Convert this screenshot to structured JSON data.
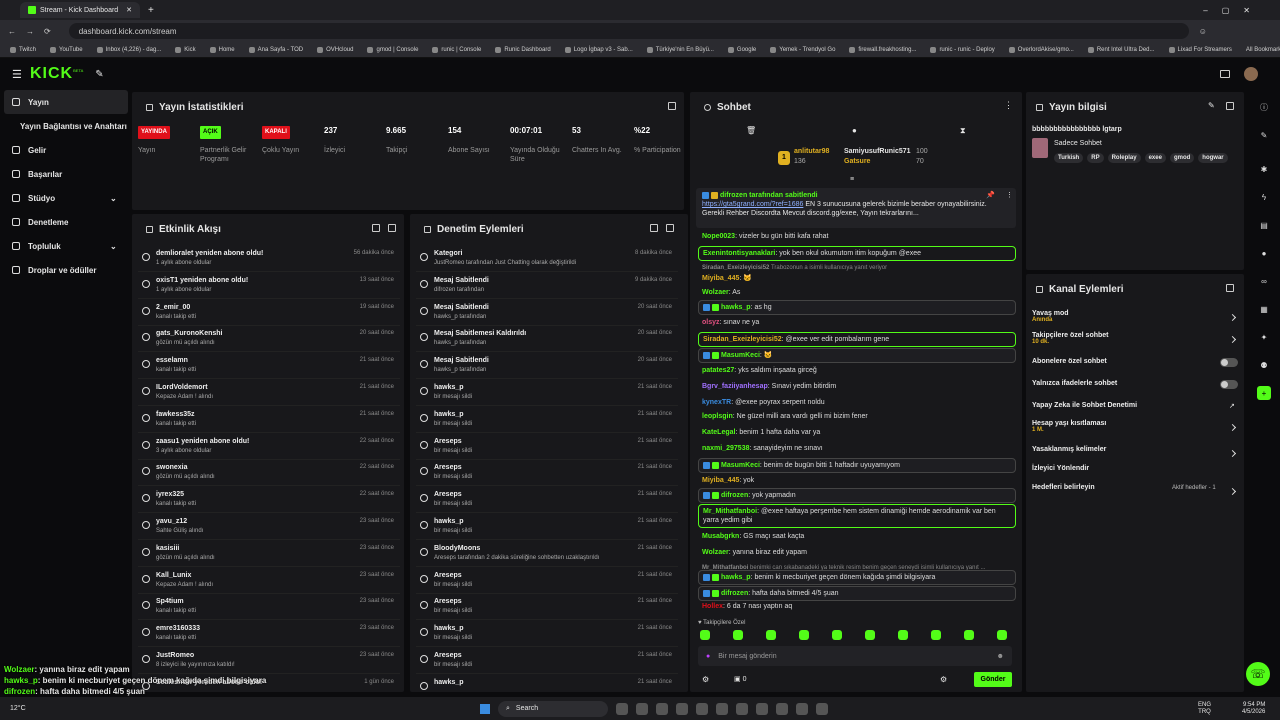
{
  "browser": {
    "tab_title": "Stream - Kick Dashboard",
    "url": "dashboard.kick.com/stream",
    "bookmarks": [
      "Twitch",
      "YouTube",
      "Inbox (4,226) - dag...",
      "Kick",
      "Home",
      "Ana Sayfa - TOD",
      "OVHcloud",
      "gmod | Console",
      "runic | Console",
      "Runic Dashboard",
      "Logo İgbap v3 - Sab...",
      "Türkiye'nin En Büyü...",
      "Google",
      "Yemek - Trendyol Go",
      "firewall.freakhosting...",
      "runic - runic - Deploy",
      "OverlordAkise/gmo...",
      "Rent Intel Ultra Ded...",
      "Lixad For Streamers"
    ],
    "all_bookmarks": "All Bookmarks"
  },
  "app": {
    "logo": "KICK",
    "beta": "BETA"
  },
  "sidebar": {
    "items": [
      {
        "label": "Yayın"
      },
      {
        "label": "Yayın Bağlantısı ve Anahtarı"
      },
      {
        "label": "Gelir"
      },
      {
        "label": "Başarılar"
      },
      {
        "label": "Stüdyo"
      },
      {
        "label": "Denetleme"
      },
      {
        "label": "Topluluk"
      },
      {
        "label": "Droplar ve ödüller"
      }
    ]
  },
  "stats": {
    "title": "Yayın İstatistikleri",
    "items": [
      {
        "value": "YAYINDA",
        "label": "Yayın",
        "badge": "#e0101a"
      },
      {
        "value": "AÇIK",
        "label": "Partnerlik Gelir Programı",
        "badge": "#53fc18"
      },
      {
        "value": "KAPALI",
        "label": "Çoklu Yayın",
        "badge": "#e0101a"
      },
      {
        "value": "237",
        "label": "İzleyici"
      },
      {
        "value": "9.665",
        "label": "Takipçi"
      },
      {
        "value": "154",
        "label": "Abone Sayısı"
      },
      {
        "value": "00:07:01",
        "label": "Yayında Olduğu Süre"
      },
      {
        "value": "53",
        "label": "Chatters In Avg."
      },
      {
        "value": "%22",
        "label": "% Participation"
      }
    ]
  },
  "activity": {
    "title": "Etkinlik Akışı",
    "items": [
      {
        "t": "demlioralet yeniden abone oldu!",
        "s": "1 aylık abone oldular",
        "tm": "56 dakika önce"
      },
      {
        "t": "oxisT1 yeniden abone oldu!",
        "s": "1 aylık abone oldular",
        "tm": "13 saat önce"
      },
      {
        "t": "2_emir_00",
        "s": "kanalı takip etti",
        "tm": "19 saat önce"
      },
      {
        "t": "gats_KuronoKenshi",
        "s": "gözün mü açıldı alındı",
        "tm": "20 saat önce"
      },
      {
        "t": "esselamn",
        "s": "kanalı takip etti",
        "tm": "21 saat önce"
      },
      {
        "t": "ILordVoldemort",
        "s": "Kepaze Adam ! alındı",
        "tm": "21 saat önce"
      },
      {
        "t": "fawkess35z",
        "s": "kanalı takip etti",
        "tm": "21 saat önce"
      },
      {
        "t": "zaasu1 yeniden abone oldu!",
        "s": "3 aylık abone oldular",
        "tm": "22 saat önce"
      },
      {
        "t": "swonexia",
        "s": "gözün mü açıldı alındı",
        "tm": "22 saat önce"
      },
      {
        "t": "iyrex325",
        "s": "kanalı takip etti",
        "tm": "22 saat önce"
      },
      {
        "t": "yavu_z12",
        "s": "Sahte Güliş alındı",
        "tm": "23 saat önce"
      },
      {
        "t": "kasisiii",
        "s": "gözün mü açıldı alındı",
        "tm": "23 saat önce"
      },
      {
        "t": "Kall_Lunix",
        "s": "Kepaze Adam ! alındı",
        "tm": "23 saat önce"
      },
      {
        "t": "Sp4tium",
        "s": "kanalı takip etti",
        "tm": "23 saat önce"
      },
      {
        "t": "emre3160333",
        "s": "kanalı takip etti",
        "tm": "23 saat önce"
      },
      {
        "t": "JustRomeo",
        "s": "8 izleyici ile yayınınıza katıldı!",
        "tm": "23 saat önce"
      },
      {
        "t": "Sealesnow yeniden abone oldu!",
        "s": "",
        "tm": "1 gün önce"
      }
    ]
  },
  "moderation": {
    "title": "Denetim Eylemleri",
    "items": [
      {
        "t": "Kategori",
        "s": "JustRomeo tarafından Just Chatting olarak değiştirildi",
        "tm": "8 dakika önce"
      },
      {
        "t": "Mesaj Sabitlendi",
        "s": "difrozen tarafından",
        "tm": "9 dakika önce"
      },
      {
        "t": "Mesaj Sabitlendi",
        "s": "hawks_p tarafından",
        "tm": "20 saat önce"
      },
      {
        "t": "Mesaj Sabitlemesi Kaldırıldı",
        "s": "hawks_p tarafından",
        "tm": "20 saat önce"
      },
      {
        "t": "Mesaj Sabitlendi",
        "s": "hawks_p tarafından",
        "tm": "20 saat önce"
      },
      {
        "t": "hawks_p",
        "s": "bir mesajı sildi",
        "tm": "21 saat önce"
      },
      {
        "t": "hawks_p",
        "s": "bir mesajı sildi",
        "tm": "21 saat önce"
      },
      {
        "t": "Areseps",
        "s": "bir mesajı sildi",
        "tm": "21 saat önce"
      },
      {
        "t": "Areseps",
        "s": "bir mesajı sildi",
        "tm": "21 saat önce"
      },
      {
        "t": "Areseps",
        "s": "bir mesajı sildi",
        "tm": "21 saat önce"
      },
      {
        "t": "hawks_p",
        "s": "bir mesajı sildi",
        "tm": "21 saat önce"
      },
      {
        "t": "BloodyMoons",
        "s": "Areseps tarafından 2 dakika süreliğine sohbetten uzaklaştırıldı",
        "tm": "21 saat önce"
      },
      {
        "t": "Areseps",
        "s": "bir mesajı sildi",
        "tm": "21 saat önce"
      },
      {
        "t": "Areseps",
        "s": "bir mesajı sildi",
        "tm": "21 saat önce"
      },
      {
        "t": "hawks_p",
        "s": "bir mesajı sildi",
        "tm": "21 saat önce"
      },
      {
        "t": "Areseps",
        "s": "bir mesajı sildi",
        "tm": "21 saat önce"
      },
      {
        "t": "hawks_p",
        "s": "",
        "tm": "21 saat önce"
      }
    ]
  },
  "chat": {
    "title": "Sohbet",
    "leader": {
      "rank": "1",
      "name": "anlitutar98",
      "count": "136",
      "second": "SamiyusufRunic571",
      "second_count": "100",
      "third": "Gatsure",
      "third_count": "70"
    },
    "pinned": {
      "by": "difrozen tarafından sabitlendi",
      "link": "https://gta5grand.com/?ref=1686",
      "text": "EN 3 sunucusuna gelerek bizimle beraber oynayabilirsiniz. Gerekli Rehber Discordta Mevcut discord.gg/exee, Yayın tekrarlarını..."
    },
    "messages": [
      {
        "u": "Nope0023",
        "c": "#53fc18",
        "m": "vizeler bu gün bitti kafa rahat"
      },
      {
        "u": "Exenintontisyanaklari",
        "c": "#53fc18",
        "m": "yok ben okul okumutom itim kopuğum @exee",
        "hl": true
      },
      {
        "u": "Siradan_Exeizleyicisi52",
        "c": "#888",
        "m": "Trabozonun a isimli kullanıcıya yanıt veriyor",
        "reply": true
      },
      {
        "u": "Miyiba_445",
        "c": "#e0b021",
        "m": "🐱"
      },
      {
        "u": "Wolzaer",
        "c": "#53fc18",
        "m": "As"
      },
      {
        "u": "hawks_p",
        "c": "#53fc18",
        "m": "as hg",
        "mod": true
      },
      {
        "u": "olsyz",
        "c": "#e05080",
        "m": "sınav ne ya"
      },
      {
        "u": "Siradan_Exeizleyicisi52",
        "c": "#e0b021",
        "m": "@exee ver edit pombalarım gene",
        "hl": true
      },
      {
        "u": "MasumKeci",
        "c": "#53fc18",
        "m": "🐱",
        "mod": true
      },
      {
        "u": "patates27",
        "c": "#53fc18",
        "m": "yks saldım inşaata girceğ"
      },
      {
        "u": "Bgrv_faziiyanhesap",
        "c": "#a070ff",
        "m": "Sınavi yedim bitirdim"
      },
      {
        "u": "kynexTR",
        "c": "#3a8ce0",
        "m": "@exee poyrax serpent noldu"
      },
      {
        "u": "leoplsgin",
        "c": "#53fc18",
        "m": "Ne güzel milli ara vardı gelli mi bizim fener"
      },
      {
        "u": "KateLegal",
        "c": "#53fc18",
        "m": "benim 1 hafta daha var ya"
      },
      {
        "u": "naxmi_297538",
        "c": "#53fc18",
        "m": "sanayideyim ne sınavı"
      },
      {
        "u": "MasumKeci",
        "c": "#53fc18",
        "m": "benim de bugün bitti 1 haftadır uyuyamıyom",
        "mod": true
      },
      {
        "u": "Miyiba_445",
        "c": "#e0b021",
        "m": "yok"
      },
      {
        "u": "difrozen",
        "c": "#53fc18",
        "m": "yok yapmadın",
        "mod": true
      },
      {
        "u": "Mr_Mithatfanboi",
        "c": "#53fc18",
        "m": "@exee haftaya perşembe hem sistem dinamiği hemde aerodinamik var ben yarra yedim gibi",
        "hl": true
      },
      {
        "u": "Musabgrkn",
        "c": "#53fc18",
        "m": "GS maçı saat kaçta"
      },
      {
        "u": "Wolzaer",
        "c": "#53fc18",
        "m": "yanına biraz edit yapam"
      },
      {
        "u": "Mr_Mithatfanboi",
        "c": "#888",
        "m": "benimki can sıkabanadeki ya teknik resim benim geçen seneydi isimli kullanıcıya yanıt ...",
        "reply": true
      },
      {
        "u": "hawks_p",
        "c": "#53fc18",
        "m": "benim ki mecburiyet geçen dönem kağıda şimdi bilgisiyara",
        "mod": true
      },
      {
        "u": "difrozen",
        "c": "#53fc18",
        "m": "hafta daha bitmedi 4/5 şuan",
        "mod": true
      },
      {
        "u": "Hollex",
        "c": "#e0101a",
        "m": "6 da 7 nası yaptın aq"
      }
    ],
    "followers_only": "Takipçilere Özel",
    "input_placeholder": "Bir mesaj gönderin",
    "send": "Gönder",
    "count": "0"
  },
  "info": {
    "title": "Yayın bilgisi",
    "stream_title": "bbbbbbbbbbbbbbbb lgtarp",
    "sub": "Sadece Sohbet",
    "tags": [
      "Turkish",
      "RP",
      "Roleplay",
      "exee",
      "gmod",
      "hogwar"
    ]
  },
  "actions": {
    "title": "Kanal Eylemleri",
    "items": [
      {
        "l": "Yavaş mod",
        "s": "Anında",
        "type": "chev"
      },
      {
        "l": "Takipçilere özel sohbet",
        "s": "10 dk.",
        "type": "chev"
      },
      {
        "l": "Abonelere özel sohbet",
        "s": "",
        "type": "toggle"
      },
      {
        "l": "Yalnızca ifadelerle sohbet",
        "s": "",
        "type": "toggle"
      },
      {
        "l": "Yapay Zeka ile Sohbet Denetimi",
        "s": "",
        "type": "ext"
      },
      {
        "l": "Hesap yaşı kısıtlaması",
        "s": "1 M.",
        "type": "chev"
      },
      {
        "l": "Yasaklanmış kelimeler",
        "s": "",
        "type": "chev"
      },
      {
        "l": "İzleyici Yönlendir",
        "s": "",
        "type": "none"
      },
      {
        "l": "Hedefleri belirleyin",
        "s": "",
        "type": "chev",
        "extra": "Aktif hedefler - 1"
      }
    ]
  },
  "overlay": [
    {
      "u": "Wolzaer",
      "m": ": yanına biraz edit yapam",
      "c": "#53fc18"
    },
    {
      "u": "hawks_p",
      "m": ": benim ki mecburiyet geçen dönem kağıda şimdi bilgisiyara",
      "c": "#53fc18"
    },
    {
      "u": "difrozen",
      "m": ": hafta daha bitmedi 4/5 şuan",
      "c": "#53fc18"
    },
    {
      "u": "Hollex",
      "m": ": 6 da 7 nası yaptın aq",
      "c": "#e0101a"
    }
  ],
  "taskbar": {
    "search": "Search",
    "weather": "12°C",
    "lang1": "ENG",
    "lang2": "TRQ",
    "time": "9:54 PM",
    "date": "4/5/2026"
  }
}
